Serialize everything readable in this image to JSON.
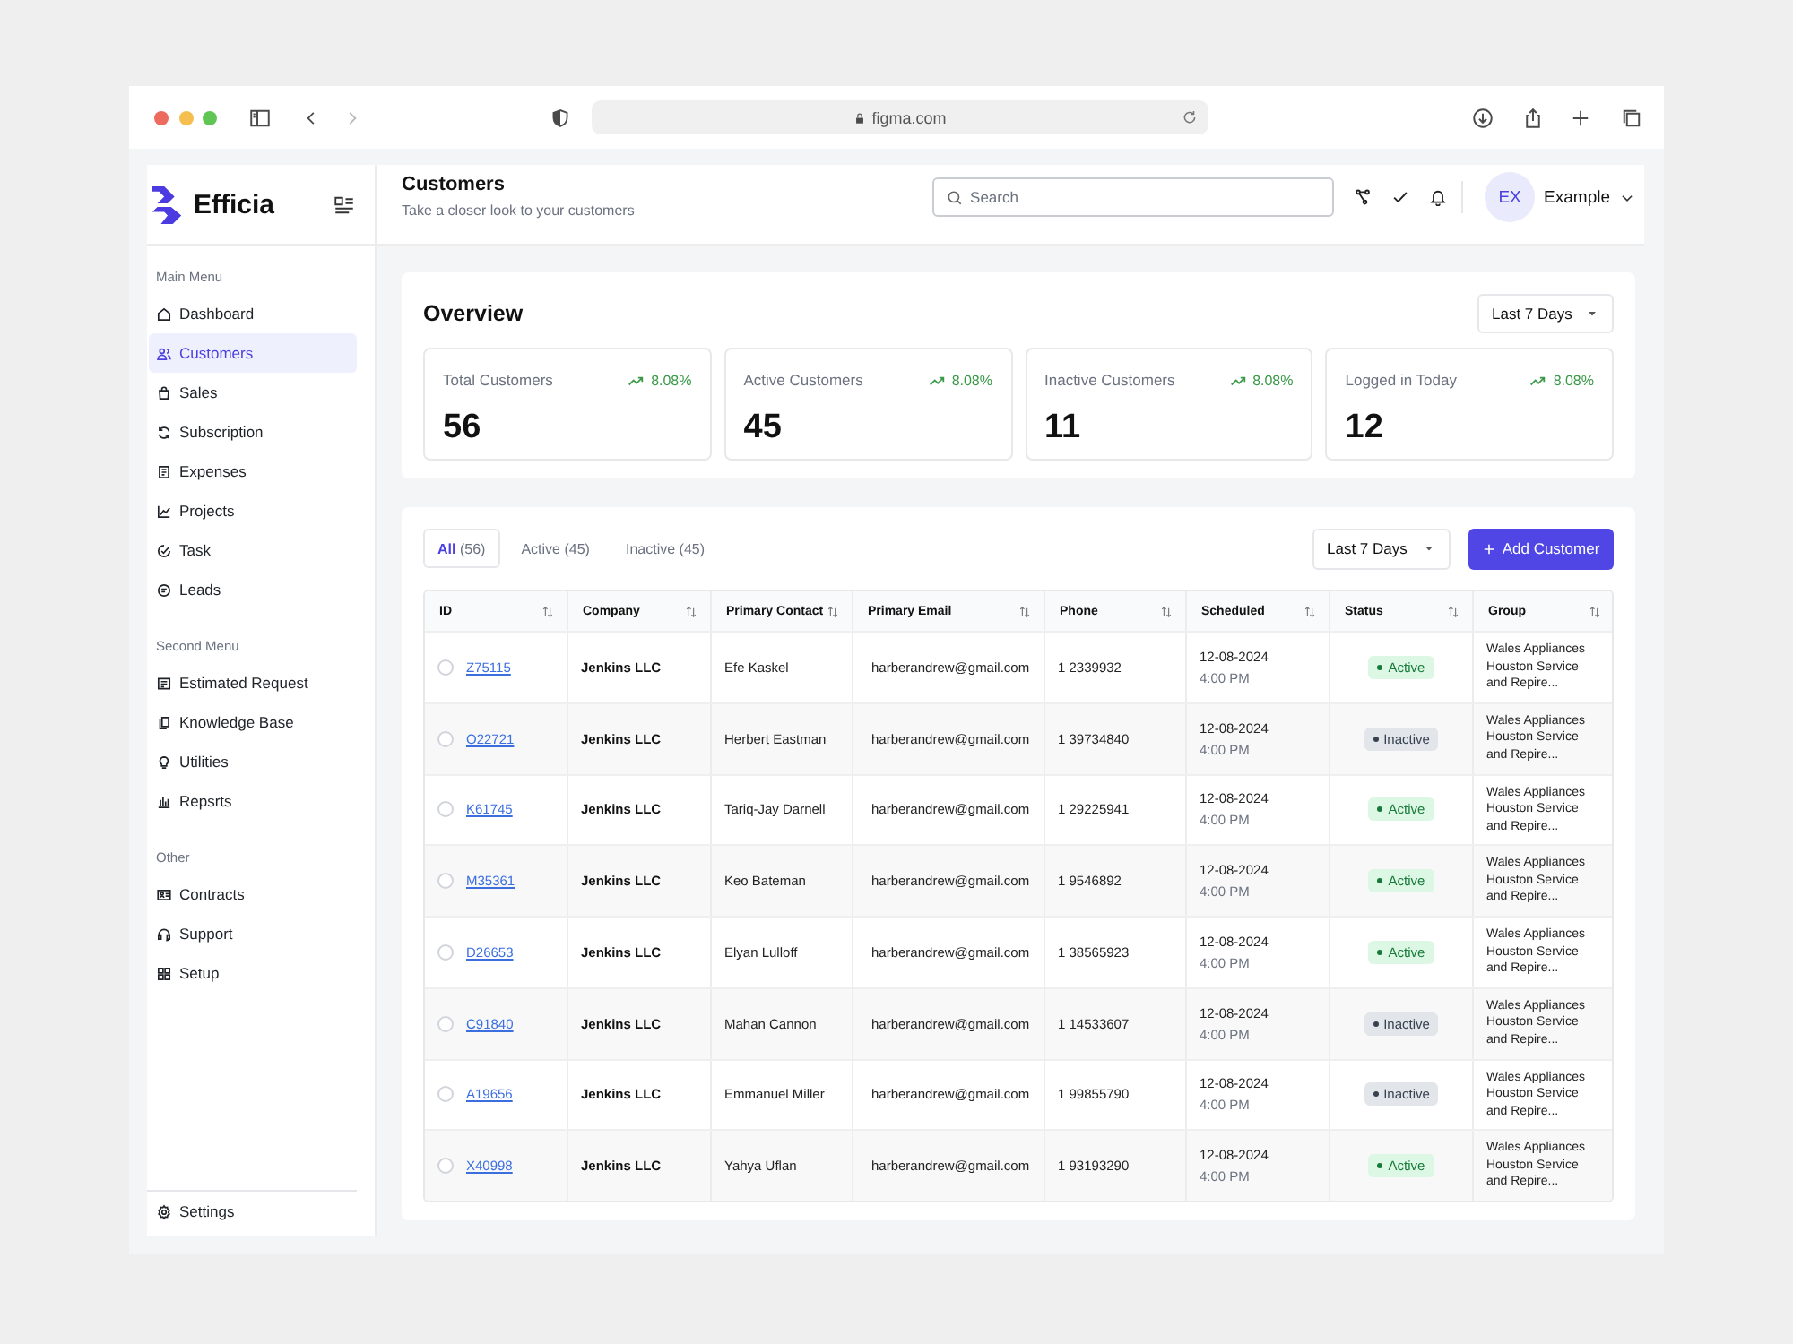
{
  "browser": {
    "address": "figma.com",
    "history_buttons": [
      {
        "disabled": false
      },
      {
        "disabled": true
      }
    ]
  },
  "sidebar": {
    "brand": "Efficia",
    "sections": [
      {
        "title": "Main Menu",
        "items": [
          {
            "label": "Dashboard",
            "selected": false
          },
          {
            "label": "Customers",
            "selected": true
          },
          {
            "label": "Sales",
            "selected": false
          },
          {
            "label": "Subscription",
            "selected": false
          },
          {
            "label": "Expenses",
            "selected": false
          },
          {
            "label": "Projects",
            "selected": false
          },
          {
            "label": "Task",
            "selected": false
          },
          {
            "label": "Leads",
            "selected": false
          }
        ]
      },
      {
        "title": "Second Menu",
        "items": [
          {
            "label": "Estimated Request",
            "selected": false
          },
          {
            "label": "Knowledge Base",
            "selected": false
          },
          {
            "label": "Utilities",
            "selected": false
          },
          {
            "label": "Repsrts",
            "selected": false
          }
        ]
      },
      {
        "title": "Other",
        "items": [
          {
            "label": "Contracts",
            "selected": false
          },
          {
            "label": "Support",
            "selected": false
          },
          {
            "label": "Setup",
            "selected": false
          }
        ]
      }
    ],
    "footer_items": [
      {
        "label": "Settings",
        "selected": false
      }
    ]
  },
  "header": {
    "title": "Customers",
    "subtitle": "Take a closer look to your customers",
    "search": {
      "placeholder": "Search"
    },
    "user": {
      "initials": "EX",
      "name": "Example"
    }
  },
  "overview": {
    "title": "Overview",
    "period": "Last 7 Days",
    "stats": [
      {
        "label": "Total Customers",
        "trend": "8.08%",
        "value": "56"
      },
      {
        "label": "Active Customers",
        "trend": "8.08%",
        "value": "45"
      },
      {
        "label": "Inactive Customers",
        "trend": "8.08%",
        "value": "11"
      },
      {
        "label": "Logged in Today",
        "trend": "8.08%",
        "value": "12"
      }
    ]
  },
  "customers": {
    "tabs": [
      {
        "label": "All",
        "count": "(56)",
        "selected": true
      },
      {
        "label": "Active",
        "count": "(45)",
        "selected": false
      },
      {
        "label": "Inactive",
        "count": "(45)",
        "selected": false
      }
    ],
    "period": "Last 7 Days",
    "add_button": "Add Customer",
    "columns": [
      "ID",
      "Company",
      "Primary Contact",
      "Primary Email",
      "Phone",
      "Scheduled",
      "Status",
      "Group"
    ],
    "rows": [
      {
        "checked": false,
        "id": "Z75115",
        "company": "Jenkins LLC",
        "contact": "Efe Kaskel",
        "email": "harberandrew@gmail.com",
        "phone": "1 2339932",
        "date": "12-08-2024",
        "time": "4:00 PM",
        "status": "Active",
        "active": true,
        "group": "Wales Appliances Houston Service and Repire..."
      },
      {
        "checked": false,
        "id": "O22721",
        "company": "Jenkins LLC",
        "contact": "Herbert Eastman",
        "email": "harberandrew@gmail.com",
        "phone": "1 39734840",
        "date": "12-08-2024",
        "time": "4:00 PM",
        "status": "Inactive",
        "active": false,
        "group": "Wales Appliances Houston Service and Repire..."
      },
      {
        "checked": false,
        "id": "K61745",
        "company": "Jenkins LLC",
        "contact": "Tariq-Jay Darnell",
        "email": "harberandrew@gmail.com",
        "phone": "1 29225941",
        "date": "12-08-2024",
        "time": "4:00 PM",
        "status": "Active",
        "active": true,
        "group": "Wales Appliances Houston Service and Repire..."
      },
      {
        "checked": false,
        "id": "M35361",
        "company": "Jenkins LLC",
        "contact": "Keo Bateman",
        "email": "harberandrew@gmail.com",
        "phone": "1 9546892",
        "date": "12-08-2024",
        "time": "4:00 PM",
        "status": "Active",
        "active": true,
        "group": "Wales Appliances Houston Service and Repire..."
      },
      {
        "checked": false,
        "id": "D26653",
        "company": "Jenkins LLC",
        "contact": "Elyan Lulloff",
        "email": "harberandrew@gmail.com",
        "phone": "1 38565923",
        "date": "12-08-2024",
        "time": "4:00 PM",
        "status": "Active",
        "active": true,
        "group": "Wales Appliances Houston Service and Repire..."
      },
      {
        "checked": false,
        "id": "C91840",
        "company": "Jenkins LLC",
        "contact": "Mahan Cannon",
        "email": "harberandrew@gmail.com",
        "phone": "1 14533607",
        "date": "12-08-2024",
        "time": "4:00 PM",
        "status": "Inactive",
        "active": false,
        "group": "Wales Appliances Houston Service and Repire..."
      },
      {
        "checked": false,
        "id": "A19656",
        "company": "Jenkins LLC",
        "contact": "Emmanuel Miller",
        "email": "harberandrew@gmail.com",
        "phone": "1 99855790",
        "date": "12-08-2024",
        "time": "4:00 PM",
        "status": "Inactive",
        "active": false,
        "group": "Wales Appliances Houston Service and Repire..."
      },
      {
        "checked": false,
        "id": "X40998",
        "company": "Jenkins LLC",
        "contact": "Yahya Uflan",
        "email": "harberandrew@gmail.com",
        "phone": "1 93193290",
        "date": "12-08-2024",
        "time": "4:00 PM",
        "status": "Active",
        "active": true,
        "group": "Wales Appliances Houston Service and Repire..."
      }
    ]
  }
}
